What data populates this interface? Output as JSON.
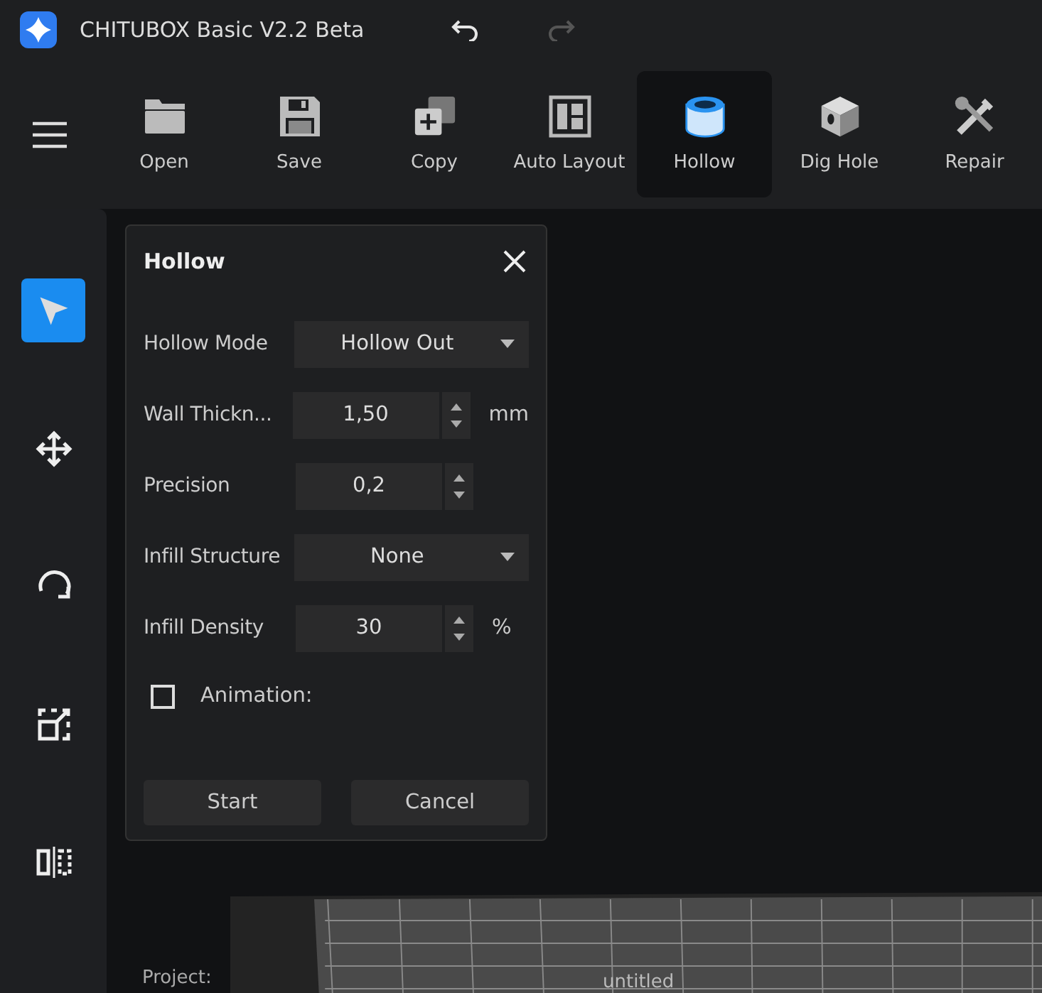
{
  "window": {
    "title": "CHITUBOX Basic V2.2 Beta",
    "undo_enabled": true,
    "redo_enabled": false
  },
  "toolbar": [
    {
      "label": "Open",
      "kind": "folder",
      "selected": false
    },
    {
      "label": "Save",
      "kind": "save",
      "selected": false
    },
    {
      "label": "Copy",
      "kind": "copy",
      "selected": false
    },
    {
      "label": "Auto Layout",
      "kind": "layout",
      "selected": false
    },
    {
      "label": "Hollow",
      "kind": "hollow",
      "selected": true
    },
    {
      "label": "Dig Hole",
      "kind": "cube",
      "selected": false
    },
    {
      "label": "Repair",
      "kind": "tools",
      "selected": false
    }
  ],
  "sidebar": [
    {
      "kind": "select",
      "selected": true
    },
    {
      "kind": "move",
      "selected": false
    },
    {
      "kind": "rotate",
      "selected": false
    },
    {
      "kind": "scale",
      "selected": false
    },
    {
      "kind": "mirror",
      "selected": false
    }
  ],
  "panel": {
    "title": "Hollow",
    "fields": [
      {
        "kind": "select",
        "label": "Hollow Mode",
        "value": "Hollow Out"
      },
      {
        "kind": "spin",
        "label": "Wall Thickn...",
        "value": "1,50",
        "unit": "mm"
      },
      {
        "kind": "spin",
        "label": "Precision",
        "value": "0,2"
      },
      {
        "kind": "select",
        "label": "Infill Structure",
        "value": "None"
      },
      {
        "kind": "spin",
        "label": "Infill Density",
        "value": "30",
        "unit": "%"
      }
    ],
    "checkbox": {
      "label": "Animation:",
      "checked": false
    },
    "buttons": [
      "Start",
      "Cancel"
    ]
  },
  "viewport": {
    "project_label": "Project:",
    "project_name": "untitled"
  }
}
